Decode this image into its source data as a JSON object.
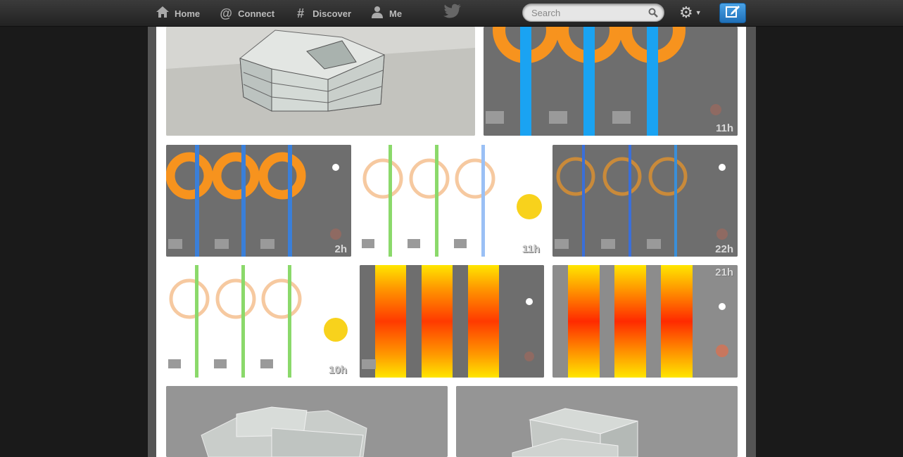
{
  "nav": {
    "home": "Home",
    "connect": "Connect",
    "discover": "Discover",
    "me": "Me"
  },
  "search": {
    "placeholder": "Search"
  },
  "colors": {
    "accent": "#2b85d0",
    "topbar": "#2e2e2e",
    "sun": "#f8d21c"
  },
  "tiles": {
    "t1": {
      "hour": "11h"
    },
    "t2": {
      "hour": "2h"
    },
    "t3": {
      "hour": "11h"
    },
    "t4": {
      "hour": "22h"
    },
    "t5": {
      "hour": "10h"
    },
    "t6": {
      "hour": "21h"
    }
  },
  "icons": [
    "home-icon",
    "at-icon",
    "hash-icon",
    "person-icon",
    "twitter-bird-icon",
    "search-icon",
    "gear-icon",
    "compose-icon"
  ]
}
